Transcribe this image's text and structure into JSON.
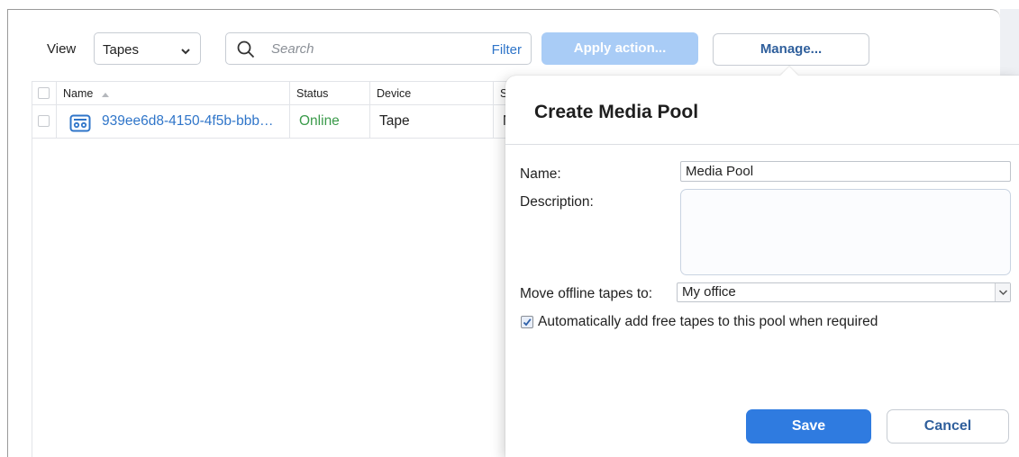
{
  "toolbar": {
    "view_label": "View",
    "view_value": "Tapes",
    "search_placeholder": "Search",
    "filter_label": "Filter",
    "apply_action_label": "Apply action...",
    "manage_label": "Manage..."
  },
  "table": {
    "columns": [
      "Name",
      "Status",
      "Device",
      "S"
    ],
    "rows": [
      {
        "name": "939ee6d8-4150-4f5b-bbb…",
        "status": "Online",
        "device": "Tape",
        "extra": "N"
      }
    ]
  },
  "dialog": {
    "title": "Create Media Pool",
    "name_label": "Name:",
    "name_value": "Media Pool",
    "description_label": "Description:",
    "description_value": "",
    "move_label": "Move offline tapes to:",
    "move_value": "My office",
    "auto_add_label": "Automatically add free tapes to this pool when required",
    "auto_add_checked": true,
    "save_label": "Save",
    "cancel_label": "Cancel"
  },
  "colors": {
    "accent": "#2f7be0",
    "link": "#2f75c9",
    "online": "#3a9a4a",
    "apply_disabled": "#a9ccf6"
  },
  "icons": {
    "search": "search-icon",
    "dropdown": "chevron-down-icon",
    "tape": "tape-icon",
    "sort": "sort-ascending-icon"
  }
}
